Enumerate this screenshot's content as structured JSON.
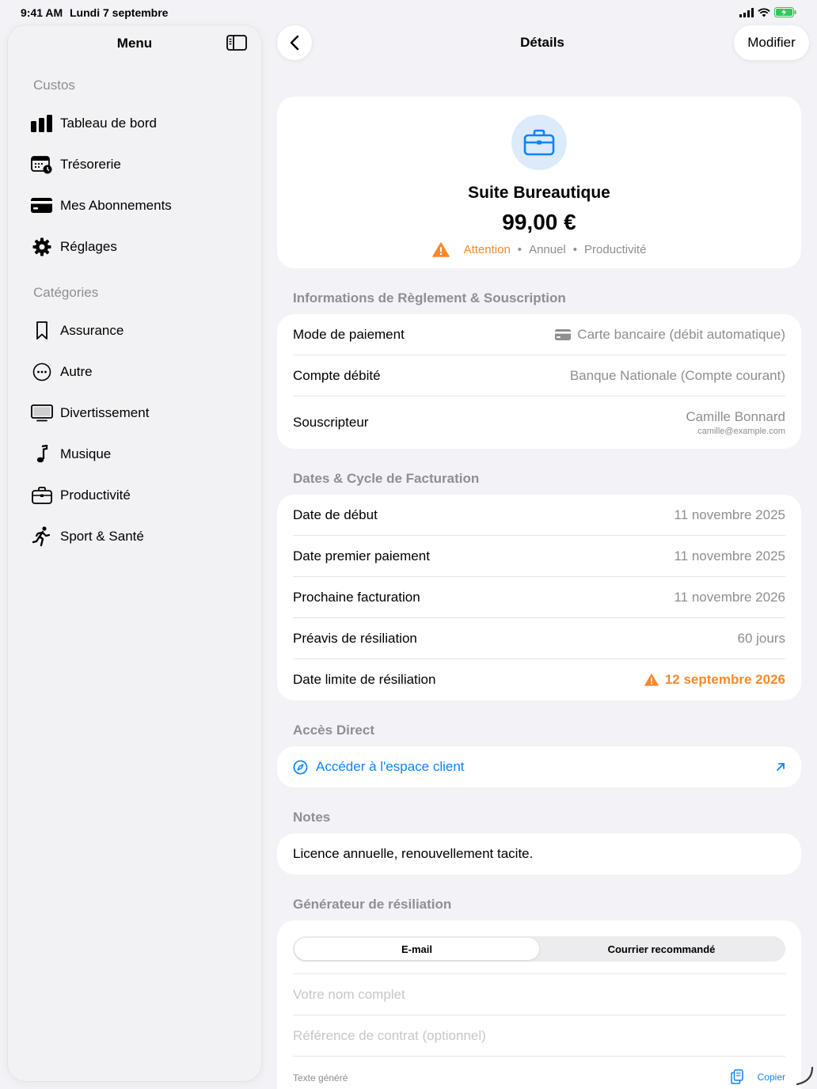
{
  "status": {
    "time": "9:41 AM",
    "date": "Lundi 7 septembre"
  },
  "sidebar": {
    "title": "Menu",
    "section1": "Custos",
    "items1": [
      {
        "label": "Tableau de bord",
        "icon": "chart-bar-icon"
      },
      {
        "label": "Trésorerie",
        "icon": "calendar-clock-icon"
      },
      {
        "label": "Mes Abonnements",
        "icon": "credit-card-icon"
      },
      {
        "label": "Réglages",
        "icon": "gear-icon"
      }
    ],
    "section2": "Catégories",
    "items2": [
      {
        "label": "Assurance",
        "icon": "bookmark-icon"
      },
      {
        "label": "Autre",
        "icon": "ellipsis-circle-icon"
      },
      {
        "label": "Divertissement",
        "icon": "tv-icon"
      },
      {
        "label": "Musique",
        "icon": "music-note-icon"
      },
      {
        "label": "Productivité",
        "icon": "briefcase-icon"
      },
      {
        "label": "Sport & Santé",
        "icon": "running-figure-icon"
      }
    ]
  },
  "header": {
    "title": "Détails",
    "edit_label": "Modifier"
  },
  "hero": {
    "name": "Suite Bureautique",
    "price": "99,00 €",
    "status": "Attention",
    "cycle": "Annuel",
    "category": "Productivité",
    "sep": "•"
  },
  "payment": {
    "label": "Informations de Règlement & Souscription",
    "rows": [
      {
        "k": "Mode de paiement",
        "v": "Carte bancaire (débit automatique)"
      },
      {
        "k": "Compte débité",
        "v": "Banque Nationale (Compte courant)"
      }
    ],
    "subscriber_label": "Souscripteur",
    "subscriber_name": "Camille Bonnard",
    "subscriber_email": "camille@example.com"
  },
  "dates": {
    "label": "Dates & Cycle de Facturation",
    "rows": [
      {
        "k": "Date de début",
        "v": "11 novembre 2025"
      },
      {
        "k": "Date premier paiement",
        "v": "11 novembre 2025"
      },
      {
        "k": "Prochaine facturation",
        "v": "11 novembre 2026"
      },
      {
        "k": "Préavis de résiliation",
        "v": "60 jours"
      },
      {
        "k": "Date limite de résiliation",
        "v": "12 septembre 2026"
      }
    ]
  },
  "access": {
    "label": "Accès Direct",
    "link": "Accéder à l'espace client"
  },
  "notes": {
    "label": "Notes",
    "text": "Licence annuelle, renouvellement tacite."
  },
  "generator": {
    "label": "Générateur de résiliation",
    "tabs": [
      "E-mail",
      "Courrier recommandé"
    ],
    "name_placeholder": "Votre nom complet",
    "ref_placeholder": "Référence de contrat (optionnel)",
    "generated_label": "Texte généré",
    "copy_label": "Copier"
  },
  "colors": {
    "accent": "#0a84ff",
    "warning": "#f7892b",
    "hero_bg": "#dcebfb"
  }
}
